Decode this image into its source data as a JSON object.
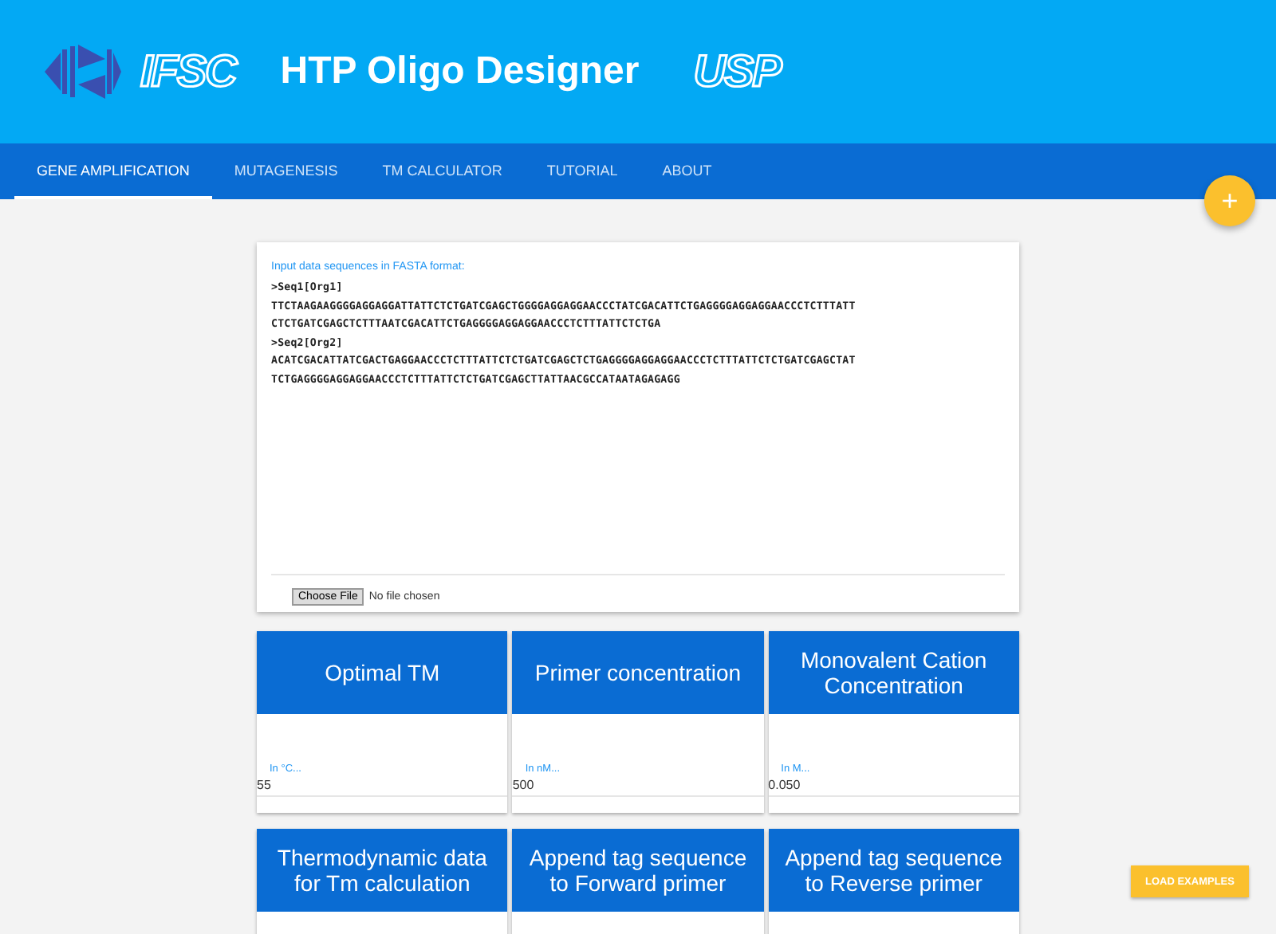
{
  "header": {
    "logo_left": "IFSC",
    "title": "HTP Oligo Designer",
    "logo_right": "USP"
  },
  "tabs": [
    {
      "label": "GENE AMPLIFICATION",
      "selected": true
    },
    {
      "label": "MUTAGENESIS",
      "selected": false
    },
    {
      "label": "TM CALCULATOR",
      "selected": false
    },
    {
      "label": "TUTORIAL",
      "selected": false
    },
    {
      "label": "ABOUT",
      "selected": false
    }
  ],
  "fab": "+",
  "input_card": {
    "label": "Input data sequences in FASTA format:",
    "lines": [
      ">Seq1[Org1]",
      "TTCTAAGAAGGGGAGGAGGATTATTCTCTGATCGAGCTGGGGAGGAGGAACCCTATCGACATTCTGAGGGGAGGAGGAACCCTCTTTATT",
      "CTCTGATCGAGCTCTTTAATCGACATTCTGAGGGGAGGAGGAACCCTCTTTATTCTCTGA",
      ">Seq2[Org2]",
      "ACATCGACATTATCGACTGAGGAACCCTCTTTATTCTCTGATCGAGCTCTGAGGGGAGGAGGAACCCTCTTTATTCTCTGATCGAGCTAT",
      "TCTGAGGGGAGGAGGAACCCTCTTTATTCTCTGATCGAGCTTATTAACGCCATAATAGAGAGG"
    ],
    "file_button": "Choose File",
    "file_status": "No file chosen"
  },
  "parameters": [
    {
      "title": "Optimal TM",
      "hint": "In °C...",
      "value": "55"
    },
    {
      "title": "Primer concentration",
      "hint": "In nM...",
      "value": "500"
    },
    {
      "title": "Monovalent Cation Concentration",
      "hint": "In M...",
      "value": "0.050"
    },
    {
      "title": "Thermodynamic data for Tm calculation"
    },
    {
      "title": "Append tag sequence to Forward primer"
    },
    {
      "title": "Append tag sequence to Reverse primer"
    }
  ],
  "load_button": "LOAD EXAMPLES"
}
